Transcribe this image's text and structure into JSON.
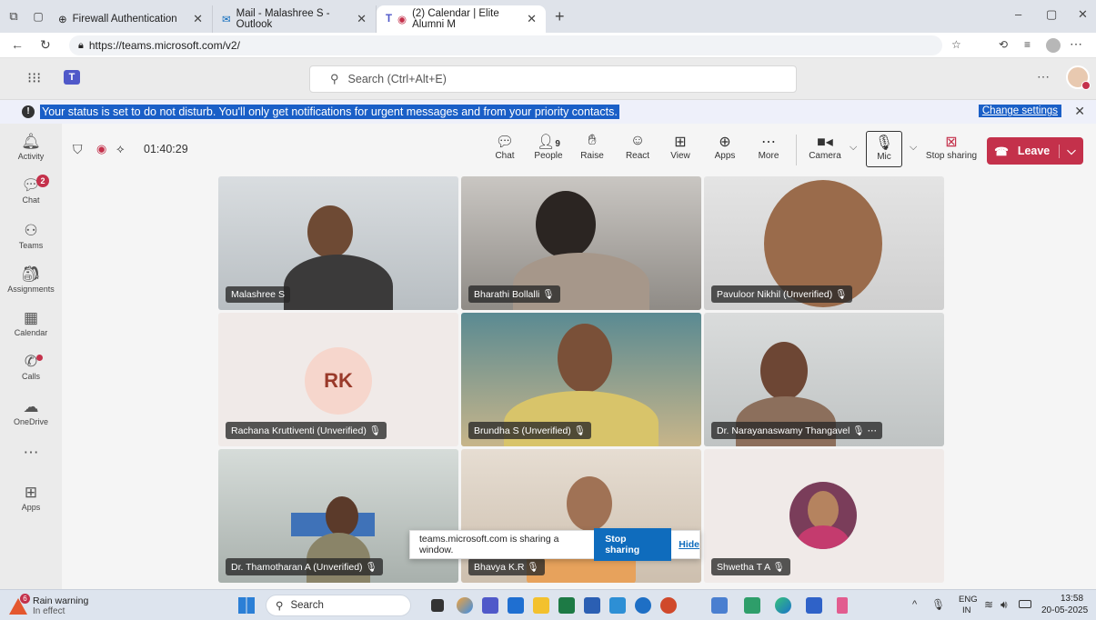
{
  "browser": {
    "tabs": [
      {
        "title": "Firewall Authentication"
      },
      {
        "title": "Mail - Malashree S - Outlook"
      },
      {
        "title": "(2) Calendar | Elite Alumni M"
      }
    ],
    "url": "https://teams.microsoft.com/v2/"
  },
  "teams": {
    "search_placeholder": "Search (Ctrl+Alt+E)",
    "banner_message": "Your status is set to do not disturb. You'll only get notifications for urgent messages and from your priority contacts.",
    "banner_action": "Change settings",
    "rail": [
      {
        "label": "Activity",
        "icon": "bell-icon"
      },
      {
        "label": "Chat",
        "icon": "chat-icon",
        "badge": "2"
      },
      {
        "label": "Teams",
        "icon": "teams-icon"
      },
      {
        "label": "Assignments",
        "icon": "assignments-icon"
      },
      {
        "label": "Calendar",
        "icon": "calendar-icon"
      },
      {
        "label": "Calls",
        "icon": "calls-icon"
      },
      {
        "label": "OneDrive",
        "icon": "cloud-icon"
      },
      {
        "label": "Apps",
        "icon": "apps-icon"
      }
    ]
  },
  "meeting": {
    "timer": "01:40:29",
    "people_count": "9",
    "toolbar": [
      {
        "label": "Chat",
        "icon": "chat-icon"
      },
      {
        "label": "People",
        "icon": "people-icon"
      },
      {
        "label": "Raise",
        "icon": "hand-icon"
      },
      {
        "label": "React",
        "icon": "smile-icon"
      },
      {
        "label": "View",
        "icon": "view-icon"
      },
      {
        "label": "Apps",
        "icon": "plus-icon"
      },
      {
        "label": "More",
        "icon": "more-icon"
      },
      {
        "label": "Camera",
        "icon": "camera-icon"
      },
      {
        "label": "Mic",
        "icon": "mic-icon"
      },
      {
        "label": "Stop sharing",
        "icon": "stop-share-icon"
      }
    ],
    "leave_label": "Leave",
    "participants": [
      {
        "name": "Malashree S"
      },
      {
        "name": "Bharathi Bollalli"
      },
      {
        "name": "Pavuloor Nikhil (Unverified)"
      },
      {
        "name": "Rachana Kruttiventi (Unverified)",
        "initials": "RK"
      },
      {
        "name": "Brundha S (Unverified)"
      },
      {
        "name": "Dr. Narayanaswamy Thangavel"
      },
      {
        "name": "Dr. Thamotharan A (Unverified)"
      },
      {
        "name": "Bhavya K.R"
      },
      {
        "name": "Shwetha T A"
      }
    ],
    "share_notice": {
      "text": "teams.microsoft.com is sharing a window.",
      "stop_label": "Stop sharing",
      "hide_label": "Hide"
    }
  },
  "taskbar": {
    "weather_title": "Rain warning",
    "weather_sub": "In effect",
    "weather_badge": "6",
    "search_label": "Search",
    "lang_top": "ENG",
    "lang_bottom": "IN",
    "time": "13:58",
    "date": "20-05-2025"
  }
}
